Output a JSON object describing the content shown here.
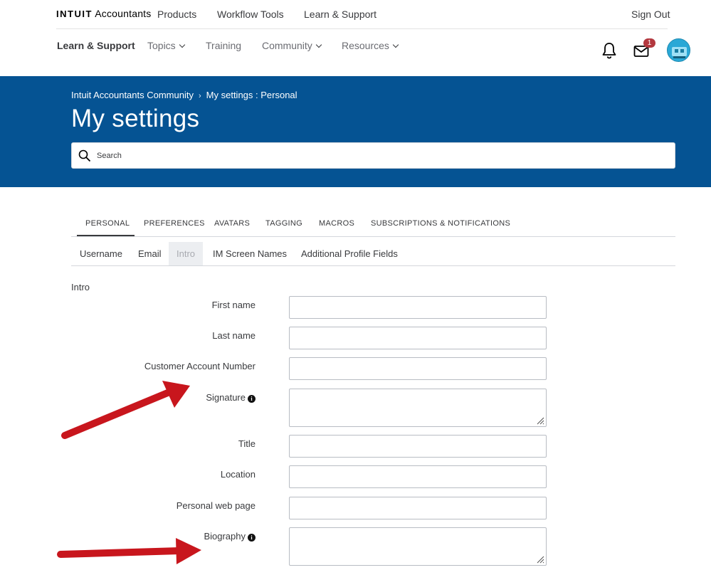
{
  "top_nav": {
    "logo_brand": "INTUIT",
    "logo_product": "Accountants",
    "products": "Products",
    "workflow_tools": "Workflow Tools",
    "learn_support": "Learn & Support",
    "sign_out": "Sign Out"
  },
  "sub_nav": {
    "brand": "Learn & Support",
    "topics": "Topics",
    "training": "Training",
    "community": "Community",
    "resources": "Resources",
    "notification_icon": "bell-icon",
    "mail_icon": "envelope-icon",
    "mail_badge": "1"
  },
  "hero": {
    "breadcrumb_root": "Intuit Accountants Community",
    "breadcrumb_sep": "›",
    "breadcrumb_current": "My settings : Personal",
    "title": "My settings",
    "search_placeholder": "Search",
    "background_color": "#055393"
  },
  "tabs": [
    "PERSONAL",
    "PREFERENCES",
    "AVATARS",
    "TAGGING",
    "MACROS",
    "SUBSCRIPTIONS & NOTIFICATIONS"
  ],
  "subtabs": [
    "Username",
    "Email",
    "Intro",
    "IM Screen Names",
    "Additional Profile Fields"
  ],
  "section_label": "Intro",
  "fields": {
    "first_name": "First name",
    "last_name": "Last name",
    "customer_account_number": "Customer Account Number",
    "signature": "Signature",
    "title": "Title",
    "location": "Location",
    "personal_web_page": "Personal web page",
    "biography": "Biography"
  },
  "annotation_color": "#c8161d"
}
